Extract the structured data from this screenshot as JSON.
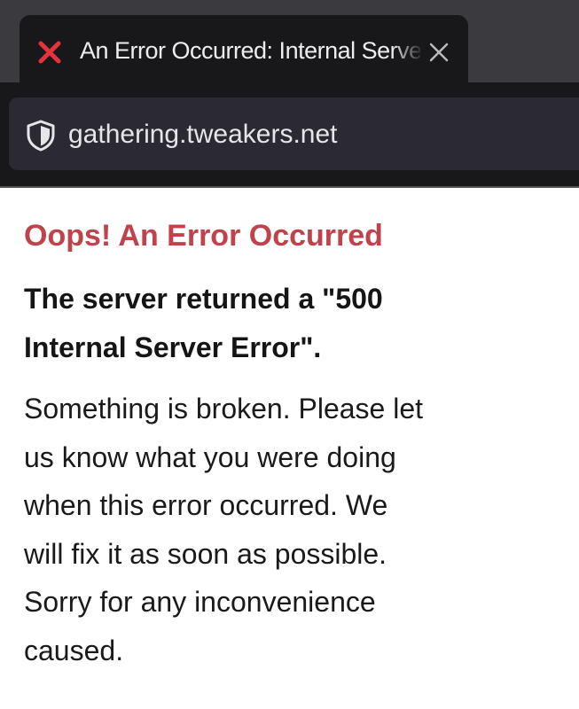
{
  "browser": {
    "tab": {
      "title": "An Error Occurred: Internal Server Error",
      "status_icon": "error-x-icon",
      "close_icon": "close-icon"
    },
    "url_bar": {
      "security_icon": "shield-icon",
      "url": "gathering.tweakers.net"
    }
  },
  "page": {
    "title": "Oops! An Error Occurred",
    "subtitle_lines": [
      "The server returned a \"500",
      "Internal Server Error\"."
    ],
    "message_lines": [
      "Something is broken. Please let",
      "us know what you were doing",
      "when this error occurred. We",
      "will fix it as soon as possible.",
      "Sorry for any inconvenience",
      "caused."
    ]
  },
  "colors": {
    "chrome_background": "#18181b",
    "tab_strip": "#3a3a3f",
    "url_bar": "#2b2a33",
    "error_icon": "#e5323b",
    "error_title": "#c0424b",
    "text": "#151515"
  }
}
